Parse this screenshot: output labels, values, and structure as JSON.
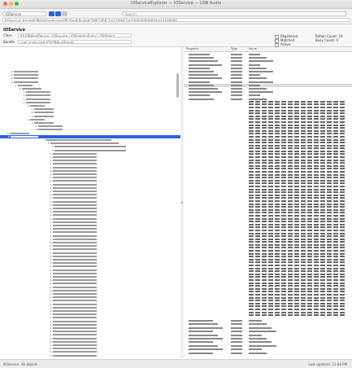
{
  "window": {
    "title": "IOServiceExplorer — IOService — USB Audio"
  },
  "toolbar": {
    "selector_value": "IOService",
    "search_placeholder": "Search",
    "path": "IOService:/AppleACPIPlatformExpert/PCI0@0/AppleACPIPCI/XHC1@14/XHC1@14000000/HS04@14100000"
  },
  "header": {
    "title": "IOService",
    "class_label": "Class",
    "class_value": "IOUSBHostDevice : IOService : IORegistryEntry : OSObject",
    "bundle_label": "Bundle",
    "bundle_value": "com.apple.iokit.IOUSBHostFamily",
    "options": [
      "Registered",
      "Matched",
      "Active"
    ],
    "counts": [
      "Retain Count: 19",
      "Busy Count: 0"
    ]
  },
  "right": {
    "col_property": "Property",
    "col_type": "Type",
    "col_value": "Value"
  },
  "status": {
    "left": "IOService: 48 objects",
    "right": "Last updated: 12:04 PM"
  }
}
